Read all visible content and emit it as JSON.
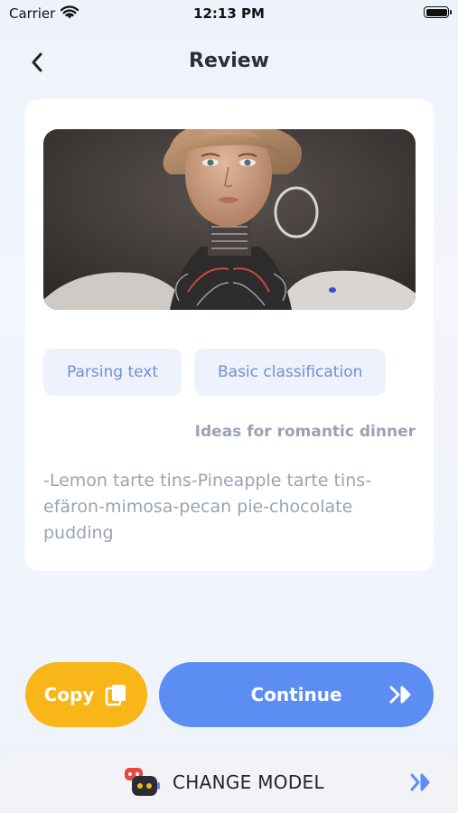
{
  "status_bar": {
    "carrier": "Carrier",
    "time": "12:13 PM"
  },
  "header": {
    "title": "Review",
    "back_icon": "chevron-left-icon"
  },
  "card": {
    "image_alt": "Portrait of a woman-like robot with exposed circuitry and a hoop earring",
    "chips": [
      "Parsing text",
      "Basic classification"
    ],
    "idea_title": "Ideas for romantic dinner",
    "idea_body": "-Lemon tarte tins-Pineapple tarte tins-efäron-mimosa-pecan pie-chocolate pudding"
  },
  "actions": {
    "copy_label": "Copy",
    "copy_icon": "copy-icon",
    "continue_label": "Continue",
    "continue_icon": "double-chevron-right-icon"
  },
  "model_bar": {
    "label": "CHANGE MODEL",
    "icon": "robot-model-icon",
    "arrow_icon": "double-chevron-right-icon"
  },
  "colors": {
    "accent_blue": "#5c8df2",
    "copy_yellow": "#f8b619",
    "chip_bg": "#eef2fc",
    "chip_text": "#6f8fd6",
    "muted_text": "#9aa3b5"
  }
}
